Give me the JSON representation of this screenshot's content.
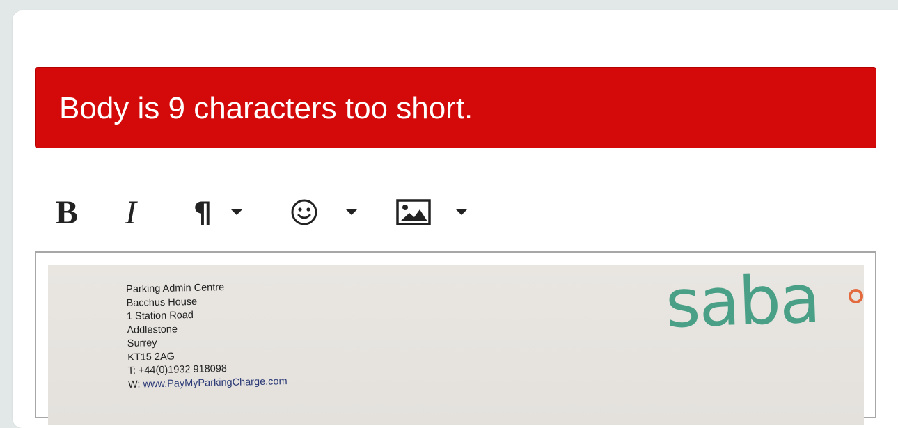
{
  "error": {
    "message": "Body is 9 characters too short."
  },
  "toolbar": {
    "bold_label": "B",
    "italic_label": "I",
    "paragraph_glyph": "¶",
    "items": [
      {
        "name": "bold",
        "icon": "bold-icon"
      },
      {
        "name": "italic",
        "icon": "italic-icon"
      },
      {
        "name": "paragraph-format",
        "icon": "pilcrow-icon",
        "has_dropdown": true
      },
      {
        "name": "emoji",
        "icon": "smiley-icon",
        "has_dropdown": true
      },
      {
        "name": "image",
        "icon": "image-icon",
        "has_dropdown": true
      }
    ]
  },
  "editor": {
    "embedded_image": {
      "address_lines": [
        "Parking Admin Centre",
        "Bacchus House",
        "1 Station Road",
        "Addlestone",
        "Surrey",
        "KT15 2AG",
        "T: +44(0)1932 918098"
      ],
      "web_prefix": "W:",
      "web_url": "www.PayMyParkingCharge.com",
      "logo_text": "saba",
      "logo_color": "#4aa086",
      "logo_dot_color": "#e36a3d"
    }
  },
  "colors": {
    "error_background": "#d40a0a",
    "page_background": "#e2e8e8",
    "card_background": "#ffffff"
  }
}
